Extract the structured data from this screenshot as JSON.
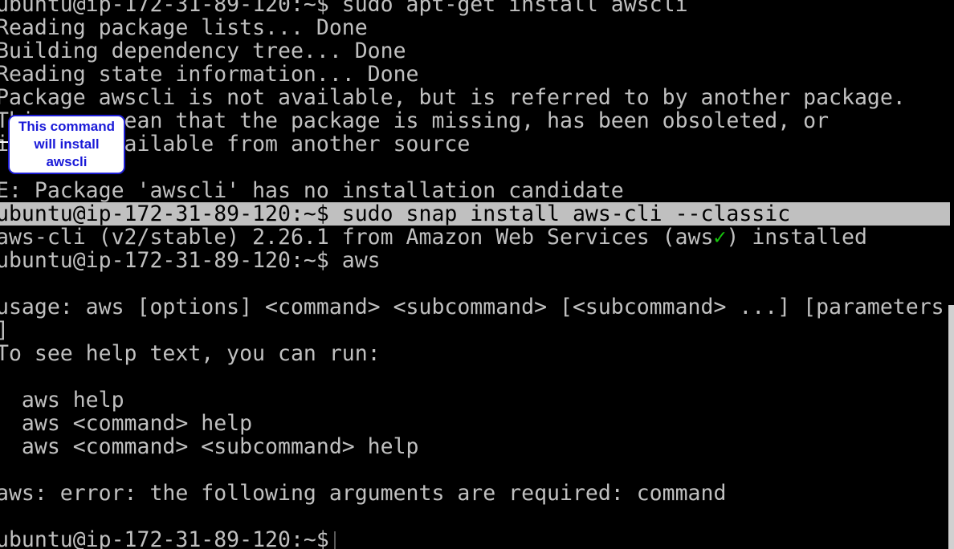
{
  "terminal": {
    "lines": [
      "ubuntu@ip-172-31-89-120:~$ sudo apt-get install awscli",
      "Reading package lists... Done",
      "Building dependency tree... Done",
      "Reading state information... Done",
      "Package awscli is not available, but is referred to by another package.",
      "This may mean that the package is missing, has been obsoleted, or",
      "is only available from another source",
      "",
      "E: Package 'awscli' has no installation candidate",
      "ubuntu@ip-172-31-89-120:~$ sudo snap install aws-cli --classic",
      {
        "before_check": "aws-cli (v2/stable) 2.26.1 from Amazon Web Services (aws",
        "check": "✓",
        "after_check": ") installed"
      },
      "ubuntu@ip-172-31-89-120:~$ aws",
      "",
      "usage: aws [options] <command> <subcommand> [<subcommand> ...] [parameters",
      "]",
      "To see help text, you can run:",
      "",
      "  aws help",
      "  aws <command> help",
      "  aws <command> <subcommand> help",
      "",
      "aws: error: the following arguments are required: command",
      "",
      "ubuntu@ip-172-31-89-120:~$"
    ],
    "colors": {
      "background": "#000000",
      "foreground": "#c0c0c0",
      "highlight_background": "#c0c0c0",
      "highlight_foreground": "#000000",
      "check": "#16c60c"
    }
  },
  "callout": {
    "lines": [
      "This command",
      "will install",
      "awscli"
    ],
    "border_color": "#1f1fd6",
    "text_color": "#1a1ad8"
  },
  "scrollbar": {
    "icon": "scrollbar-thumb"
  }
}
